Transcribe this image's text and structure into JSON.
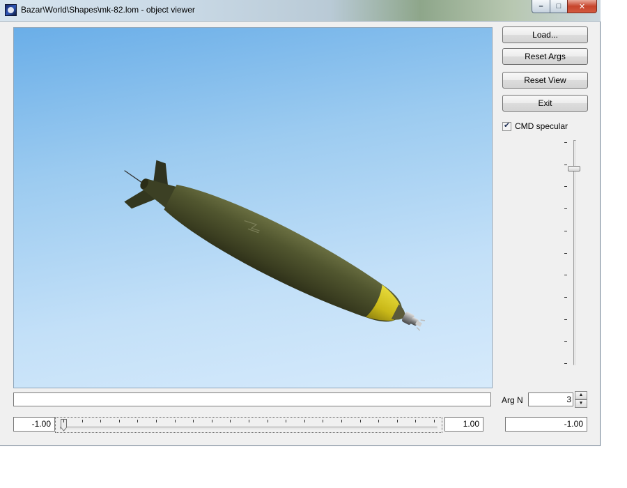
{
  "window": {
    "title": "Bazar\\World\\Shapes\\mk-82.lom - object viewer",
    "caption": {
      "minimize": "–",
      "maximize": "□",
      "close": "✕"
    }
  },
  "viewport": {
    "object": "mk-82 bomb model",
    "colors": {
      "sky_top": "#6aaee8",
      "sky_bottom": "#d6eafb",
      "body": "#4f5431",
      "nose_band": "#d4c51a"
    }
  },
  "buttons": {
    "load": "Load...",
    "reset_args": "Reset Args",
    "reset_view": "Reset View",
    "exit": "Exit"
  },
  "options": {
    "cmd_specular_label": "CMD specular",
    "cmd_specular_checked": true
  },
  "vertical_slider": {
    "tick_count": 11,
    "level_fraction": 0.12
  },
  "status": {
    "text": ""
  },
  "arg": {
    "label": "Arg N",
    "value": "3"
  },
  "range": {
    "min": "-1.00",
    "max": "1.00",
    "value": "-1.00",
    "tick_count": 21
  }
}
